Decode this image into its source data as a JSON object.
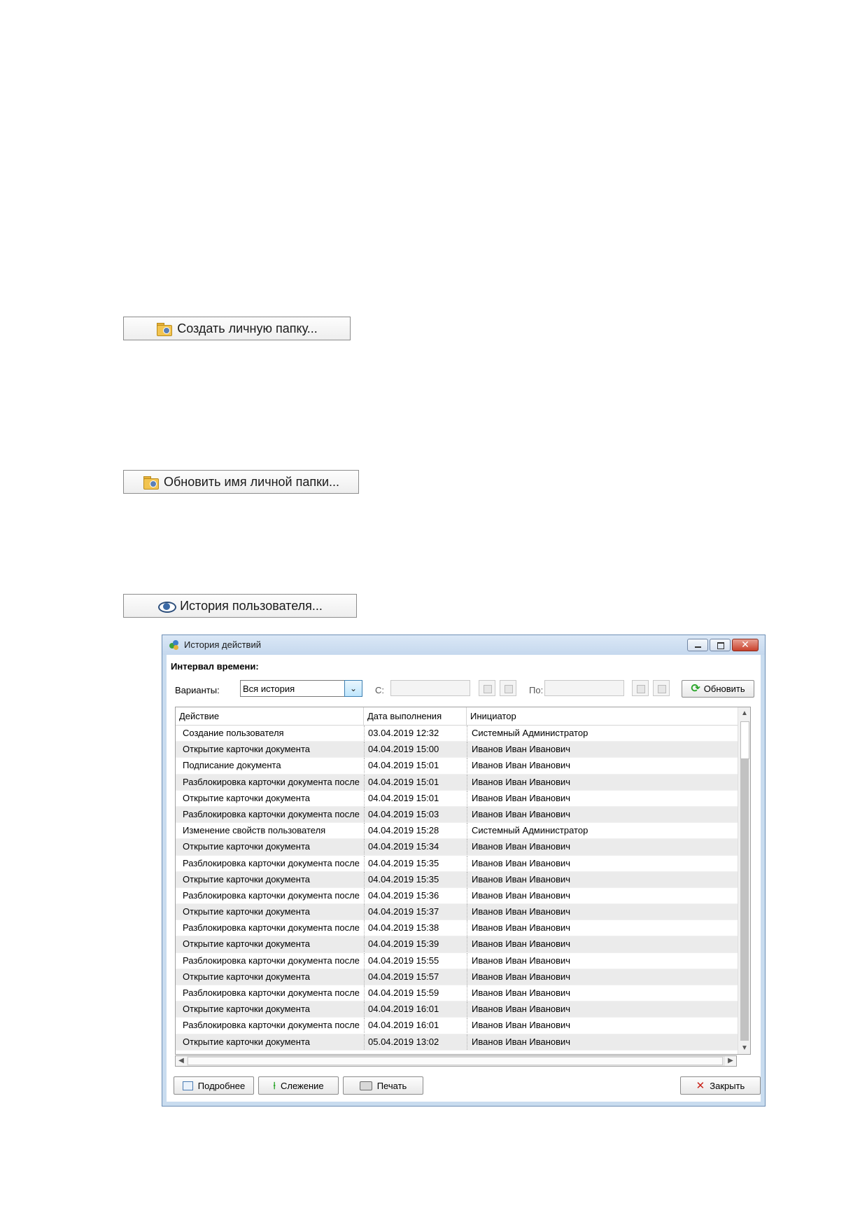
{
  "doc_buttons": {
    "create_folder": "Создать личную папку...",
    "update_folder": "Обновить имя личной папки...",
    "user_history": "История пользователя..."
  },
  "dialog": {
    "title": "История действий",
    "interval_label": "Интервал времени:",
    "variants_label": "Варианты:",
    "variants_value": "Вся история",
    "from_label": "С:",
    "to_label": "По:",
    "refresh_label": "Обновить",
    "columns": [
      "Действие",
      "Дата выполнения",
      "Инициатор"
    ],
    "rows": [
      [
        "Создание пользователя",
        "03.04.2019 12:32",
        "Системный Администратор"
      ],
      [
        "Открытие карточки документа",
        "04.04.2019 15:00",
        "Иванов Иван Иванович"
      ],
      [
        "Подписание документа",
        "04.04.2019 15:01",
        "Иванов Иван Иванович"
      ],
      [
        "Разблокировка карточки документа после",
        "04.04.2019 15:01",
        "Иванов Иван Иванович"
      ],
      [
        "Открытие карточки документа",
        "04.04.2019 15:01",
        "Иванов Иван Иванович"
      ],
      [
        "Разблокировка карточки документа после",
        "04.04.2019 15:03",
        "Иванов Иван Иванович"
      ],
      [
        "Изменение свойств пользователя",
        "04.04.2019 15:28",
        "Системный Администратор"
      ],
      [
        "Открытие карточки документа",
        "04.04.2019 15:34",
        "Иванов Иван Иванович"
      ],
      [
        "Разблокировка карточки документа после",
        "04.04.2019 15:35",
        "Иванов Иван Иванович"
      ],
      [
        "Открытие карточки документа",
        "04.04.2019 15:35",
        "Иванов Иван Иванович"
      ],
      [
        "Разблокировка карточки документа после",
        "04.04.2019 15:36",
        "Иванов Иван Иванович"
      ],
      [
        "Открытие карточки документа",
        "04.04.2019 15:37",
        "Иванов Иван Иванович"
      ],
      [
        "Разблокировка карточки документа после",
        "04.04.2019 15:38",
        "Иванов Иван Иванович"
      ],
      [
        "Открытие карточки документа",
        "04.04.2019 15:39",
        "Иванов Иван Иванович"
      ],
      [
        "Разблокировка карточки документа после",
        "04.04.2019 15:55",
        "Иванов Иван Иванович"
      ],
      [
        "Открытие карточки документа",
        "04.04.2019 15:57",
        "Иванов Иван Иванович"
      ],
      [
        "Разблокировка карточки документа после",
        "04.04.2019 15:59",
        "Иванов Иван Иванович"
      ],
      [
        "Открытие карточки документа",
        "04.04.2019 16:01",
        "Иванов Иван Иванович"
      ],
      [
        "Разблокировка карточки документа после",
        "04.04.2019 16:01",
        "Иванов Иван Иванович"
      ],
      [
        "Открытие карточки документа",
        "05.04.2019 13:02",
        "Иванов Иван Иванович"
      ]
    ],
    "footer": {
      "details_label": "Подробнее",
      "track_label": "Слежение",
      "print_label": "Печать",
      "close_label": "Закрыть"
    }
  },
  "icons": {
    "folder": "user-folder-icon",
    "eye": "eye-icon",
    "refresh": "refresh-icon",
    "details": "details-icon",
    "pin": "pin-icon",
    "print": "printer-icon",
    "close": "close-icon"
  },
  "colors": {
    "window_frame": "#c9dcef",
    "close_button": "#c9412c",
    "zebra_row": "#ebebeb"
  }
}
